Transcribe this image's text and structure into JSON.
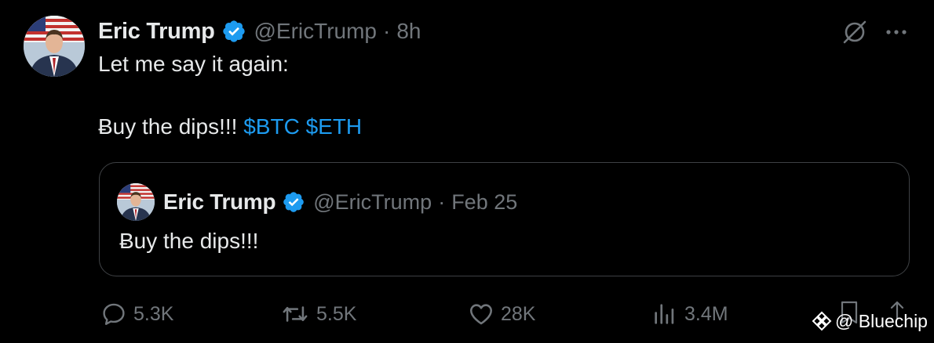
{
  "tweet": {
    "author": {
      "display_name": "Eric Trump",
      "handle": "@EricTrump",
      "verified": true
    },
    "separator": "·",
    "time": "8h",
    "text_line1": "Let me say it again:",
    "text_line2_prefix": "Ƀuy the dips!!!",
    "cashtags": [
      "$BTC",
      "$ETH"
    ],
    "cashtag_btc": "$BTC",
    "cashtag_eth": "$ETH"
  },
  "quote": {
    "author": {
      "display_name": "Eric Trump",
      "handle": "@EricTrump",
      "verified": true
    },
    "separator": "·",
    "date": "Feb 25",
    "text": "Ƀuy the dips!!!"
  },
  "actions": {
    "replies": "5.3K",
    "reposts": "5.5K",
    "likes": "28K",
    "views": "3.4M"
  },
  "icons": {
    "verified": "verified-badge-icon",
    "grok": "grok-icon",
    "more": "more-options-icon",
    "reply": "reply-icon",
    "repost": "repost-icon",
    "like": "heart-icon",
    "views": "views-chart-icon",
    "bookmark": "bookmark-icon",
    "share": "share-icon"
  },
  "colors": {
    "background": "#000000",
    "primary_text": "#e7e9ea",
    "secondary_text": "#71767b",
    "link": "#1d9bf0",
    "border": "#3e4144"
  },
  "watermark": {
    "text": "@ Bluechip"
  }
}
